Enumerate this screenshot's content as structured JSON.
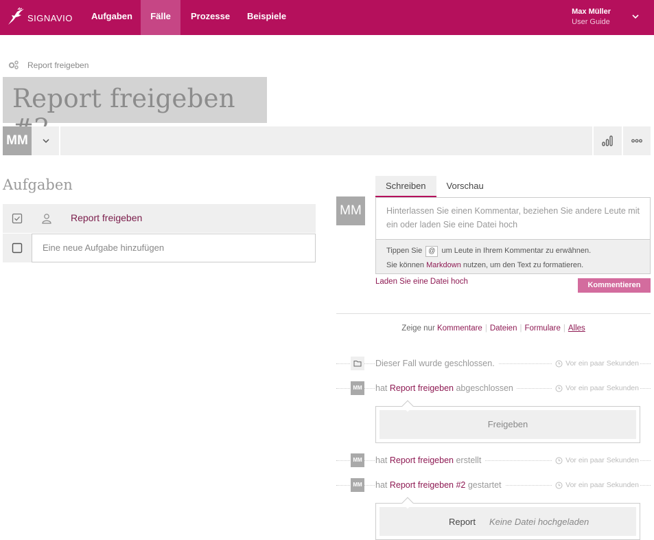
{
  "brand": {
    "name": "SIGNAVIO",
    "color": "#b5105c"
  },
  "nav": {
    "items": [
      {
        "label": "Aufgaben",
        "active": false
      },
      {
        "label": "Fälle",
        "active": true
      },
      {
        "label": "Prozesse",
        "active": false
      },
      {
        "label": "Beispiele",
        "active": false
      }
    ]
  },
  "user": {
    "name": "Max Müller",
    "subtitle": "User Guide"
  },
  "breadcrumb": {
    "label": "Report freigeben"
  },
  "case": {
    "title": "Report freigeben #2",
    "assignee_initials": "MM"
  },
  "tasks": {
    "heading": "Aufgaben",
    "items": [
      {
        "label": "Report freigeben",
        "done": true
      }
    ],
    "new_placeholder": "Eine neue Aufgabe hinzufügen"
  },
  "comment": {
    "avatar_initials": "MM",
    "tabs": [
      "Schreiben",
      "Vorschau"
    ],
    "placeholder": "Hinterlassen Sie einen Kommentar, beziehen Sie andere Leute mit ein oder laden Sie eine Datei hoch",
    "hint1_pre": "Tippen Sie",
    "hint1_key": "@",
    "hint1_post": "um Leute in Ihrem Kommentar zu erwähnen.",
    "hint2_pre": "Sie können",
    "hint2_link": "Markdown",
    "hint2_post": "nutzen, um den Text zu formatieren.",
    "upload_link": "Laden Sie eine Datei hoch",
    "submit": "Kommentieren"
  },
  "filter": {
    "prefix": "Zeige nur",
    "options": [
      "Kommentare",
      "Dateien",
      "Formulare",
      "Alles"
    ],
    "active": "Alles"
  },
  "timeline": {
    "time_label": "Vor ein paar Sekunden",
    "e1": {
      "text": "Dieser Fall wurde geschlossen."
    },
    "e2": {
      "initials": "MM",
      "pre": "hat",
      "link": "Report freigeben",
      "post": "abgeschlossen",
      "form_label": "Freigeben"
    },
    "e3": {
      "initials": "MM",
      "pre": "hat",
      "link": "Report freigeben",
      "post": "erstellt"
    },
    "e4": {
      "initials": "MM",
      "pre": "hat",
      "link": "Report freigeben #2",
      "post": "gestartet",
      "file_label": "Report",
      "file_status": "Keine Datei hochgeladen"
    }
  }
}
